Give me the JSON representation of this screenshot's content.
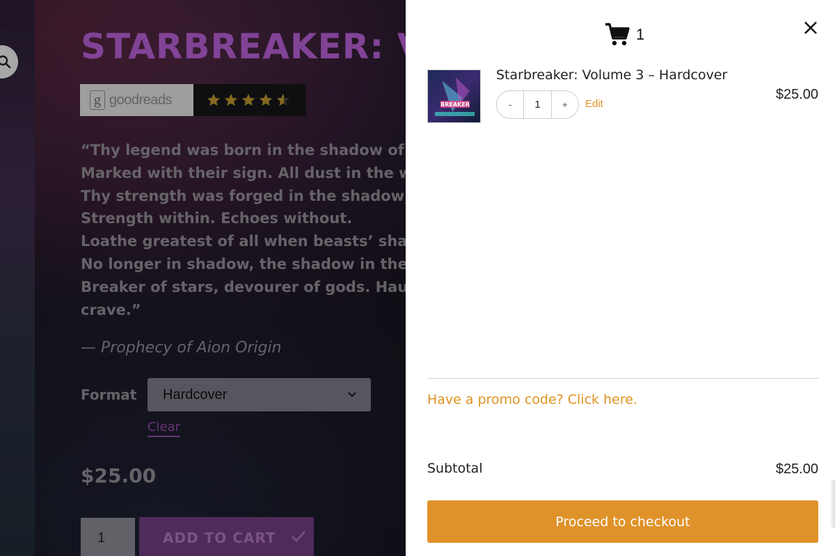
{
  "product_page": {
    "title": "STARBREAKER: VO",
    "goodreads": {
      "logo_text": "goodreads",
      "logo_letter": "g",
      "rating": 4.5
    },
    "quote_lines": [
      "“Thy legend was born in the shadow of the",
      "Marked with their sign. All dust in the wind",
      "Thy strength was forged in the shadow of th",
      "Strength within. Echoes without.",
      "Loathe greatest of all when beasts’ shadow",
      "No longer in shadow, the shadow in thee.",
      "Breaker of stars, devourer of gods. Haunte",
      "crave.”"
    ],
    "quote_attribution": "— Prophecy of Aion Origin",
    "format_label": "Format",
    "format_selected": "Hardcover",
    "clear_label": "Clear",
    "price": "$25.00",
    "quantity": "1",
    "add_to_cart_label": "ADD TO CART"
  },
  "cart": {
    "count": "1",
    "items": [
      {
        "title": "Starbreaker: Volume 3 – Hardcover",
        "quantity": "1",
        "decrement_label": "-",
        "increment_label": "+",
        "edit_label": "Edit",
        "price": "$25.00",
        "cover_text": "BREAKER"
      }
    ],
    "promo_text": "Have a promo code? Click here.",
    "subtotal_label": "Subtotal",
    "subtotal_value": "$25.00",
    "checkout_label": "Proceed to checkout"
  },
  "colors": {
    "title_purple": "#b35dd0",
    "accent_orange": "#e0922a",
    "link_orange": "#e0921f",
    "star_gold": "#e0b33a"
  },
  "icons": [
    "search-icon",
    "cart-icon",
    "close-icon",
    "chevron-down-icon",
    "check-icon",
    "star-icon"
  ]
}
